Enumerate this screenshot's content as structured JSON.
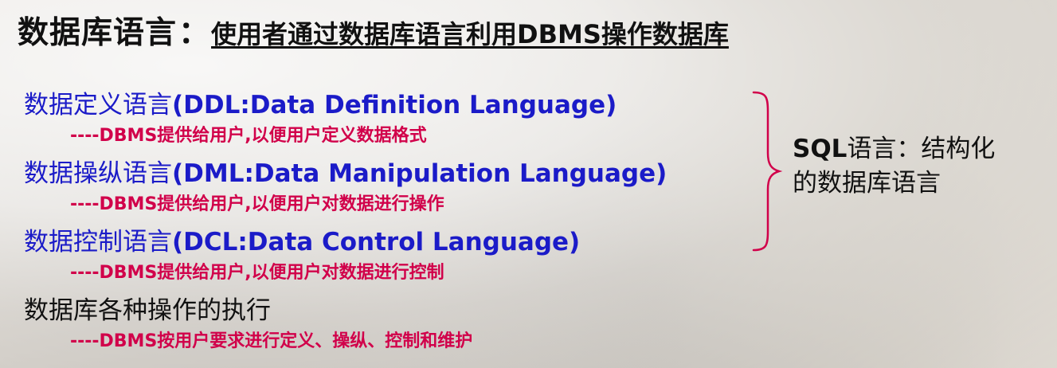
{
  "title": {
    "main": "数据库语言",
    "separator": "：",
    "sub": "使用者通过数据库语言利用DBMS操作数据库"
  },
  "languages": [
    {
      "cn": "数据定义语言",
      "en": "(DDL:Data Definition Language)",
      "desc": "----DBMS提供给用户,以便用户定义数据格式"
    },
    {
      "cn": "数据操纵语言",
      "en": "(DML:Data Manipulation Language)",
      "desc": "----DBMS提供给用户,以便用户对数据进行操作"
    },
    {
      "cn": "数据控制语言",
      "en": "(DCL:Data Control Language)",
      "desc": "----DBMS提供给用户,以便用户对数据进行控制"
    }
  ],
  "execution": {
    "text": "数据库各种操作的执行",
    "desc": "----DBMS按用户要求进行定义、操纵、控制和维护"
  },
  "sql_note": {
    "prefix": "SQL",
    "line1_rest": "语言：结构化",
    "line2": "的数据库语言"
  },
  "colors": {
    "language_blue": "#1b1bc8",
    "desc_red": "#d1004a",
    "text_black": "#111111"
  }
}
